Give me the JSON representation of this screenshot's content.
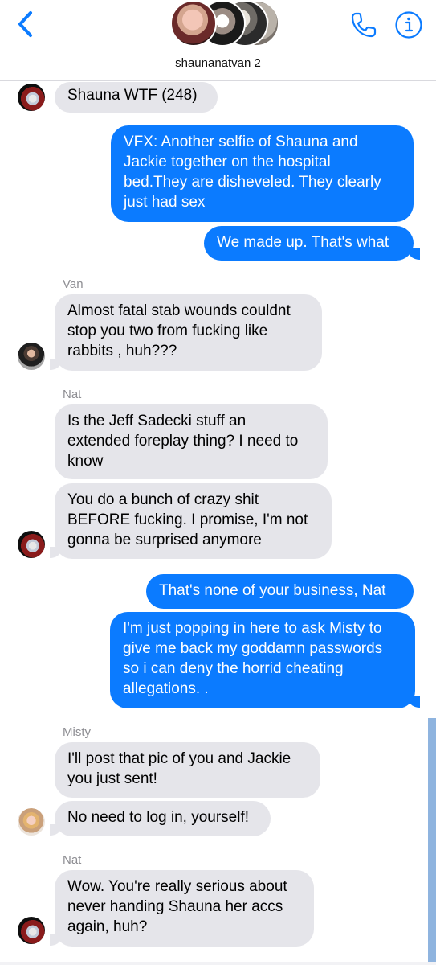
{
  "header": {
    "group_name": "shaunanatvan 2",
    "accent_color": "#0b7bff",
    "icons": [
      "back-chevron-icon",
      "phone-icon",
      "info-icon"
    ]
  },
  "messages": [
    {
      "type": "incoming",
      "sender": "",
      "text": "Shauna WTF (248)"
    },
    {
      "type": "outgoing",
      "text": "VFX: Another selfie of Shauna and\nJackie together on the hospital\nbed.They are disheveled. They clearly\njust had sex"
    },
    {
      "type": "outgoing",
      "text": "We made up. That's what"
    },
    {
      "type": "incoming",
      "sender": "Van",
      "text": "Almost fatal stab wounds couldnt\nstop you two from fucking like\nrabbits , huh???"
    },
    {
      "type": "incoming",
      "sender": "Nat",
      "text": "Is the Jeff Sadecki stuff an\nextended foreplay thing? I need to\nknow"
    },
    {
      "type": "incoming",
      "sender": "",
      "text": "You do a bunch of crazy shit\nBEFORE fucking. I promise, I'm not\ngonna be surprised anymore"
    },
    {
      "type": "outgoing",
      "text": "That's none of your business, Nat"
    },
    {
      "type": "outgoing",
      "text": "I'm just popping in here to ask Misty to\ngive me back my goddamn passwords\nso i can deny the horrid cheating\nallegations. ."
    },
    {
      "type": "incoming",
      "sender": "Misty",
      "text": "I'll post that pic of you and Jackie\nyou just sent!"
    },
    {
      "type": "incoming",
      "sender": "",
      "text": "No need to log in, yourself!"
    },
    {
      "type": "incoming",
      "sender": "Nat",
      "text": "Wow. You're really serious about\nnever handing Shauna her accs\nagain, huh?"
    }
  ]
}
